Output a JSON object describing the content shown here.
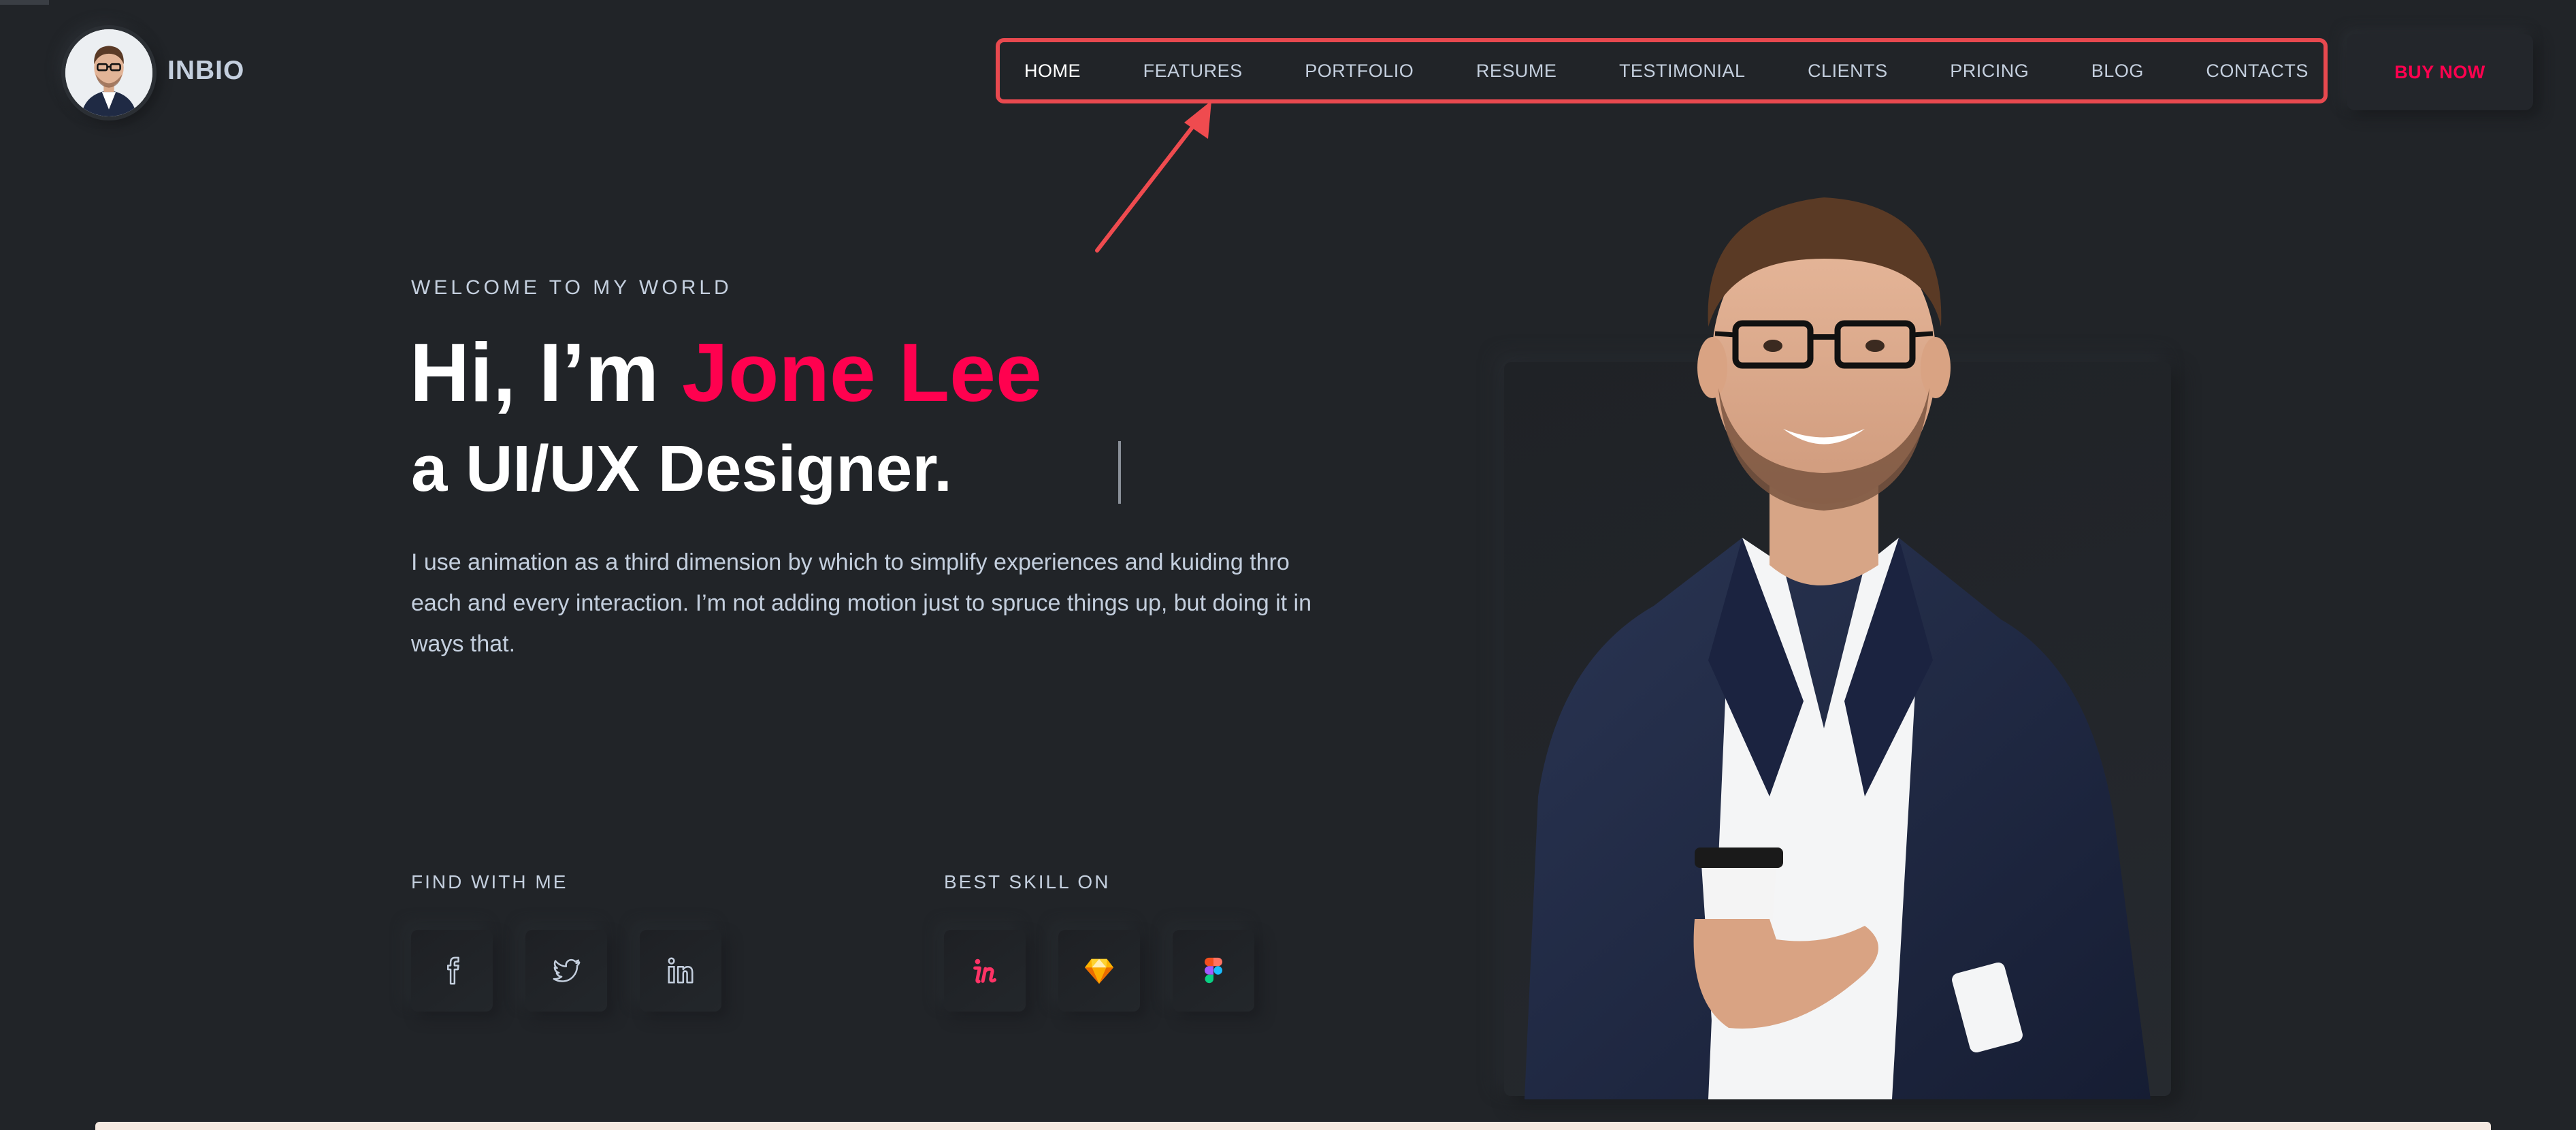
{
  "brand": {
    "name": "INBIO"
  },
  "nav": {
    "items": [
      {
        "label": "HOME",
        "active": true
      },
      {
        "label": "FEATURES"
      },
      {
        "label": "PORTFOLIO"
      },
      {
        "label": "RESUME"
      },
      {
        "label": "TESTIMONIAL"
      },
      {
        "label": "CLIENTS"
      },
      {
        "label": "PRICING"
      },
      {
        "label": "BLOG"
      },
      {
        "label": "CONTACTS"
      }
    ],
    "buy_label": "BUY NOW"
  },
  "hero": {
    "welcome": "WELCOME TO MY WORLD",
    "greeting": "Hi, I’m ",
    "name": "Jone Lee",
    "role": "a UI/UX Designer.",
    "description": "I use animation as a third dimension by which to simplify experiences and kuiding thro each and every interaction. I’m not adding motion just to spruce things up, but doing it in ways that."
  },
  "find_with_me": {
    "label": "FIND WITH ME",
    "icons": [
      "facebook-icon",
      "twitter-icon",
      "linkedin-icon"
    ]
  },
  "skills": {
    "label": "BEST SKILL ON",
    "icons": [
      "invision-icon",
      "sketch-icon",
      "figma-icon"
    ]
  },
  "colors": {
    "background": "#212428",
    "accent": "#ff014f",
    "text": "#c4cfde",
    "highlight_box": "#e8494f"
  }
}
